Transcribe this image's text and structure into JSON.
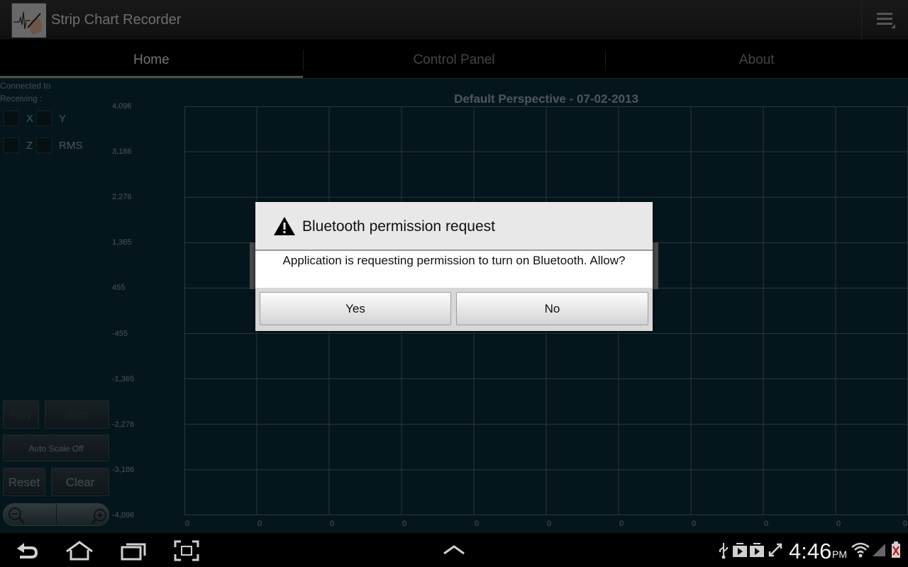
{
  "app": {
    "title": "Strip Chart Recorder"
  },
  "tabs": [
    {
      "label": "Home",
      "active": true
    },
    {
      "label": "Control Panel",
      "active": false
    },
    {
      "label": "About",
      "active": false
    }
  ],
  "sidebar": {
    "connected_label": "Connected to",
    "receiving_label": "Receiving :",
    "channels": [
      {
        "label": "X",
        "checked": false
      },
      {
        "label": "Y",
        "checked": false
      },
      {
        "label": "Z",
        "checked": false
      },
      {
        "label": "RMS",
        "checked": false
      }
    ],
    "play_label": "Play",
    "stop_label": "Stop",
    "autoscale_label": "Auto Scale Off",
    "reset_label": "Reset",
    "clear_label": "Clear"
  },
  "chart_data": {
    "type": "line",
    "title": "Default Perspective - 07-02-2013",
    "y_ticks": [
      "4,096",
      "3,186",
      "2,276",
      "1,365",
      "455",
      "-455",
      "-1,365",
      "-2,276",
      "-3,186",
      "-4,096"
    ],
    "x_ticks": [
      "0",
      "0",
      "0",
      "0",
      "0",
      "0",
      "0",
      "0",
      "0",
      "0",
      "0"
    ],
    "ylim": [
      -4096,
      4096
    ],
    "grid": true,
    "series": []
  },
  "dialog": {
    "title": "Bluetooth permission request",
    "message": "Application is requesting permission to turn on Bluetooth. Allow?",
    "yes_label": "Yes",
    "no_label": "No"
  },
  "statusbar": {
    "time": "4:46",
    "ampm": "PM"
  },
  "colors": {
    "background": "#082833",
    "grid": "#4b6570",
    "dialog": "#ffffff"
  }
}
